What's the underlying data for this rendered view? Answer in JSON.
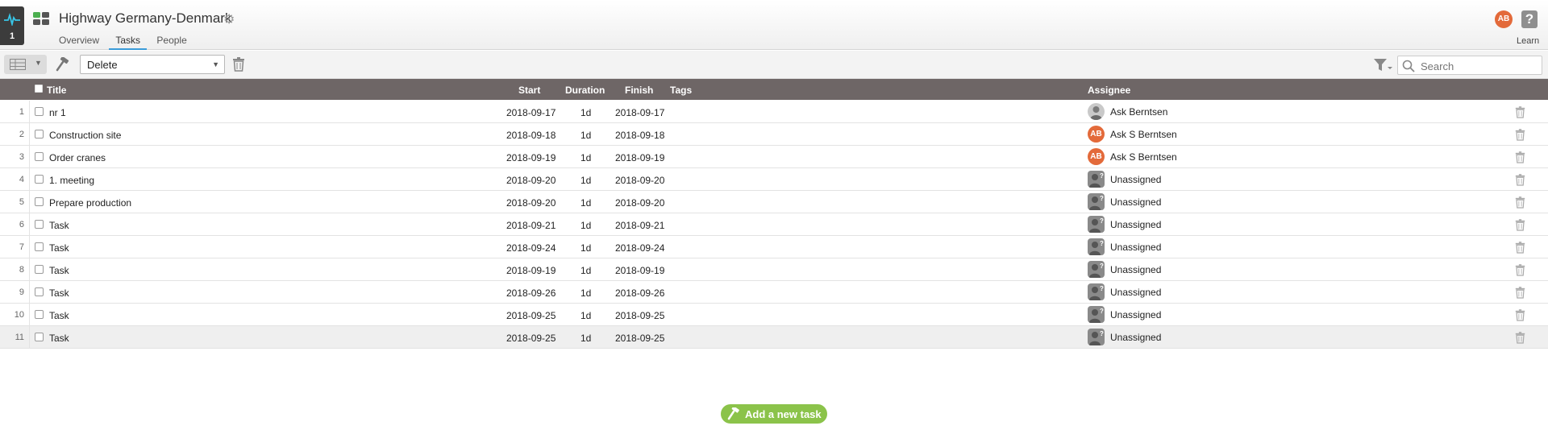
{
  "app": {
    "activity_count": "1",
    "title": "Highway Germany-Denmark",
    "user_initials": "AB",
    "help_label": "?",
    "learn_label": "Learn"
  },
  "nav": {
    "tabs": [
      {
        "label": "Overview",
        "active": false
      },
      {
        "label": "Tasks",
        "active": true
      },
      {
        "label": "People",
        "active": false
      }
    ]
  },
  "toolbar": {
    "action_selected": "Delete",
    "search_placeholder": "Search"
  },
  "table": {
    "headers": {
      "title": "Title",
      "start": "Start",
      "duration": "Duration",
      "finish": "Finish",
      "tags": "Tags",
      "assignee": "Assignee"
    },
    "rows": [
      {
        "num": "1",
        "title": "nr 1",
        "start": "2018-09-17",
        "duration": "1d",
        "finish": "2018-09-17",
        "assignee": "Ask Berntsen",
        "avatar": "photo",
        "initials": ""
      },
      {
        "num": "2",
        "title": "Construction site",
        "start": "2018-09-18",
        "duration": "1d",
        "finish": "2018-09-18",
        "assignee": "Ask S Berntsen",
        "avatar": "initials",
        "initials": "AB"
      },
      {
        "num": "3",
        "title": "Order cranes",
        "start": "2018-09-19",
        "duration": "1d",
        "finish": "2018-09-19",
        "assignee": "Ask S Berntsen",
        "avatar": "initials",
        "initials": "AB"
      },
      {
        "num": "4",
        "title": "1. meeting",
        "start": "2018-09-20",
        "duration": "1d",
        "finish": "2018-09-20",
        "assignee": "Unassigned",
        "avatar": "unassigned",
        "initials": ""
      },
      {
        "num": "5",
        "title": "Prepare production",
        "start": "2018-09-20",
        "duration": "1d",
        "finish": "2018-09-20",
        "assignee": "Unassigned",
        "avatar": "unassigned",
        "initials": ""
      },
      {
        "num": "6",
        "title": "Task",
        "start": "2018-09-21",
        "duration": "1d",
        "finish": "2018-09-21",
        "assignee": "Unassigned",
        "avatar": "unassigned",
        "initials": ""
      },
      {
        "num": "7",
        "title": "Task",
        "start": "2018-09-24",
        "duration": "1d",
        "finish": "2018-09-24",
        "assignee": "Unassigned",
        "avatar": "unassigned",
        "initials": ""
      },
      {
        "num": "8",
        "title": "Task",
        "start": "2018-09-19",
        "duration": "1d",
        "finish": "2018-09-19",
        "assignee": "Unassigned",
        "avatar": "unassigned",
        "initials": ""
      },
      {
        "num": "9",
        "title": "Task",
        "start": "2018-09-26",
        "duration": "1d",
        "finish": "2018-09-26",
        "assignee": "Unassigned",
        "avatar": "unassigned",
        "initials": ""
      },
      {
        "num": "10",
        "title": "Task",
        "start": "2018-09-25",
        "duration": "1d",
        "finish": "2018-09-25",
        "assignee": "Unassigned",
        "avatar": "unassigned",
        "initials": ""
      },
      {
        "num": "11",
        "title": "Task",
        "start": "2018-09-25",
        "duration": "1d",
        "finish": "2018-09-25",
        "assignee": "Unassigned",
        "avatar": "unassigned",
        "initials": "",
        "selected": true
      }
    ]
  },
  "add_task_label": "Add a new task",
  "colors": {
    "header_row": "#6e6666",
    "accent_tab": "#3a9bd9",
    "user_avatar": "#e36a3a",
    "add_button": "#8bc34a",
    "activity_badge": "#3c3c3c",
    "logo_tiles": [
      "#4caf50",
      "#555555",
      "#555555",
      "#555555"
    ]
  },
  "icons": {
    "activity": "pulse-icon",
    "app_logo": "grid-logo-icon",
    "settings": "gear-icon",
    "view": "table-view-icon",
    "tool": "hammer-icon",
    "trash": "trash-icon",
    "filter": "filter-icon",
    "search": "search-icon",
    "add": "hammer-icon"
  }
}
